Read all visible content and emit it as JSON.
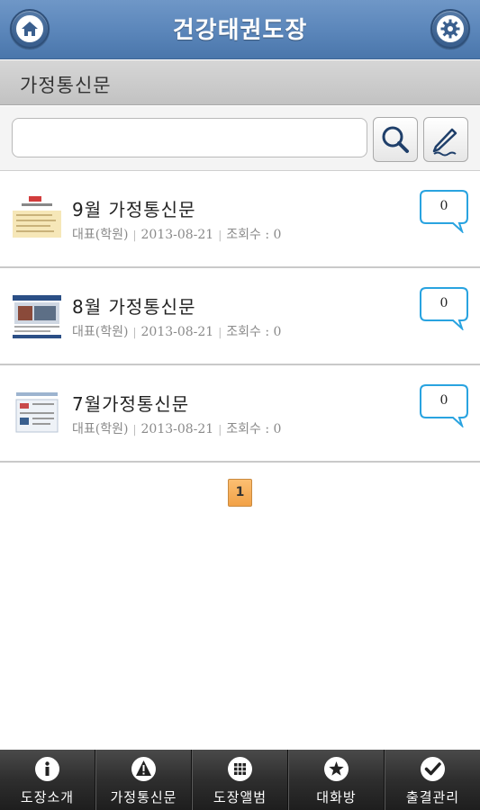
{
  "header": {
    "title": "건강태권도장",
    "home_icon": "home-icon",
    "settings_icon": "gear-icon"
  },
  "section": {
    "title": "가정통신문"
  },
  "search": {
    "value": "",
    "placeholder": ""
  },
  "posts": [
    {
      "title": "9월 가정통신문",
      "author": "대표(학원)",
      "date": "2013-08-21",
      "views": "조회수 : 0",
      "comments": "0"
    },
    {
      "title": "8월 가정통신문",
      "author": "대표(학원)",
      "date": "2013-08-21",
      "views": "조회수 : 0",
      "comments": "0"
    },
    {
      "title": "7월가정통신문",
      "author": "대표(학원)",
      "date": "2013-08-21",
      "views": "조회수 : 0",
      "comments": "0"
    }
  ],
  "pagination": {
    "current": "1"
  },
  "tabs": [
    {
      "label": "도장소개",
      "icon": "info-icon"
    },
    {
      "label": "가정통신문",
      "icon": "warning-icon"
    },
    {
      "label": "도장앨범",
      "icon": "grid-icon"
    },
    {
      "label": "대화방",
      "icon": "star-icon"
    },
    {
      "label": "출결관리",
      "icon": "check-icon"
    }
  ],
  "colors": {
    "header": "#5c87bb",
    "accent_bubble": "#29a3e0",
    "pager": "#f5ad55"
  }
}
